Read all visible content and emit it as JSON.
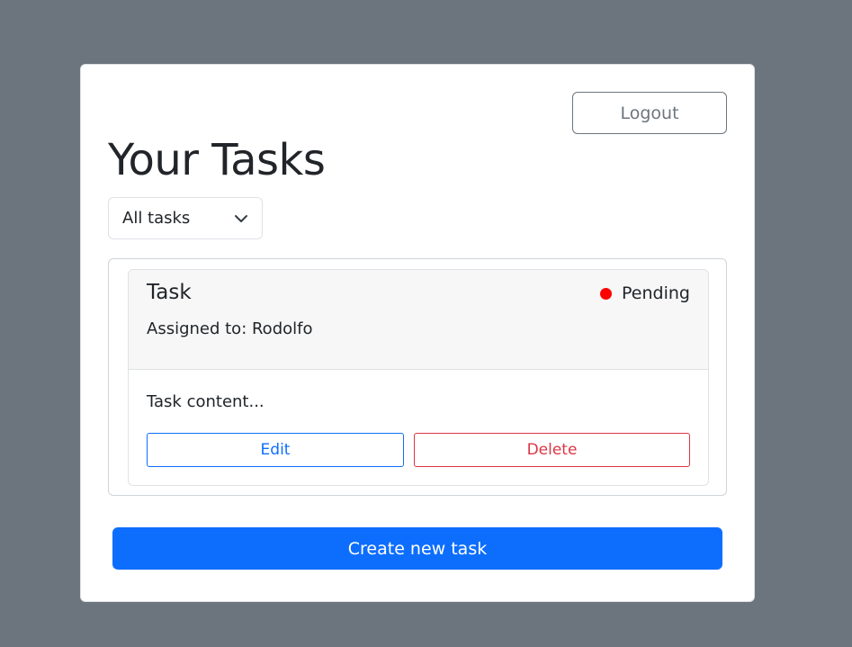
{
  "header": {
    "logout_label": "Logout",
    "title": "Your Tasks"
  },
  "filter": {
    "selected": "All tasks",
    "icon": "chevron-down-icon"
  },
  "tasks": [
    {
      "title": "Task",
      "status": "Pending",
      "status_color": "#ff0000",
      "assigned": "Assigned to: Rodolfo",
      "content": "Task content...",
      "edit_label": "Edit",
      "delete_label": "Delete"
    }
  ],
  "footer": {
    "create_label": "Create new task"
  },
  "colors": {
    "background": "#6c757d",
    "primary": "#0d6efd",
    "danger": "#dc3545",
    "secondary": "#6c757d"
  }
}
